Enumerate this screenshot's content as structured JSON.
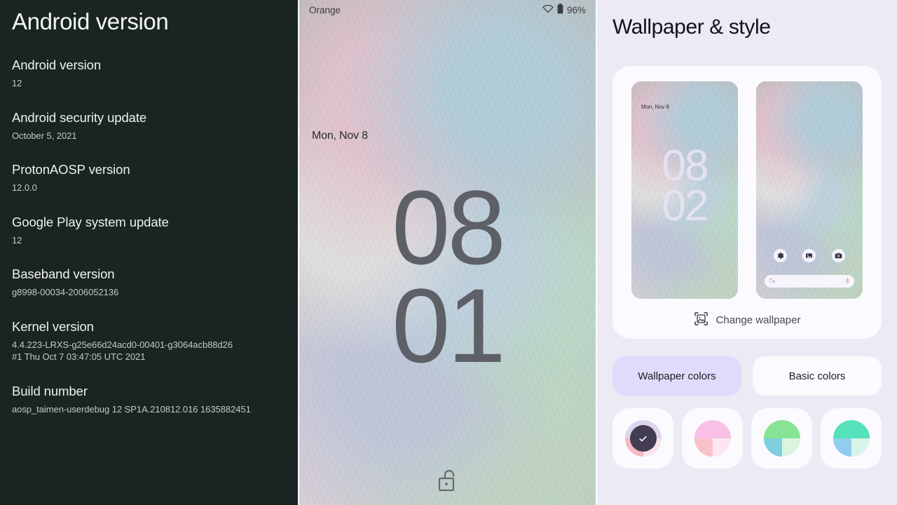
{
  "about": {
    "title": "Android version",
    "items": [
      {
        "label": "Android version",
        "value": "12"
      },
      {
        "label": "Android security update",
        "value": "October 5, 2021"
      },
      {
        "label": "ProtonAOSP version",
        "value": "12.0.0"
      },
      {
        "label": "Google Play system update",
        "value": "12"
      },
      {
        "label": "Baseband version",
        "value": "g8998-00034-2006052136"
      },
      {
        "label": "Kernel version",
        "value": "4.4.223-LRXS-g25e66d24acd0-00401-g3064acb88d26\n#1 Thu Oct 7 03:47:05 UTC 2021"
      },
      {
        "label": "Build number",
        "value": "aosp_taimen-userdebug 12 SP1A.210812.016 1635882451"
      }
    ]
  },
  "lockscreen": {
    "statusbar": {
      "carrier": "Orange",
      "wifi_icon": "wifi-icon",
      "battery_icon": "battery-icon",
      "battery_level": "96%"
    },
    "date": "Mon, Nov 8",
    "clock_hours": "08",
    "clock_minutes": "01",
    "unlock_icon": "unlock-icon"
  },
  "style": {
    "title": "Wallpaper & style",
    "preview": {
      "lock": {
        "date": "Mon, Nov 8",
        "clock_hours": "08",
        "clock_minutes": "02"
      },
      "home": {
        "app_icons": [
          "settings-gear-icon",
          "photos-icon",
          "camera-icon"
        ],
        "search_leading_icon": "google-g-icon",
        "search_trailing_icon": "microphone-icon"
      }
    },
    "change_wallpaper": {
      "icon": "image-frame-icon",
      "label": "Change wallpaper"
    },
    "tabs": [
      {
        "label": "Wallpaper colors",
        "selected": true
      },
      {
        "label": "Basic colors",
        "selected": false
      }
    ],
    "color_swatches": [
      {
        "name": "lavender-pink-swatch",
        "selected": true,
        "top": "#ddd5ef",
        "bottom_left": "#f6b8c2",
        "bottom_right": "#f9e4ea",
        "check_circle": "#423d52",
        "check_icon": "check-icon"
      },
      {
        "name": "pink-swatch",
        "selected": false,
        "top": "#f9bfe4",
        "bottom_left": "#f8c2c8",
        "bottom_right": "#fce7f1"
      },
      {
        "name": "green-swatch",
        "selected": false,
        "top": "#87e395",
        "bottom_left": "#7ed0e0",
        "bottom_right": "#dbf4dd"
      },
      {
        "name": "teal-swatch",
        "selected": false,
        "top": "#53e2ba",
        "bottom_left": "#92cdf0",
        "bottom_right": "#d8f3e8"
      }
    ]
  }
}
